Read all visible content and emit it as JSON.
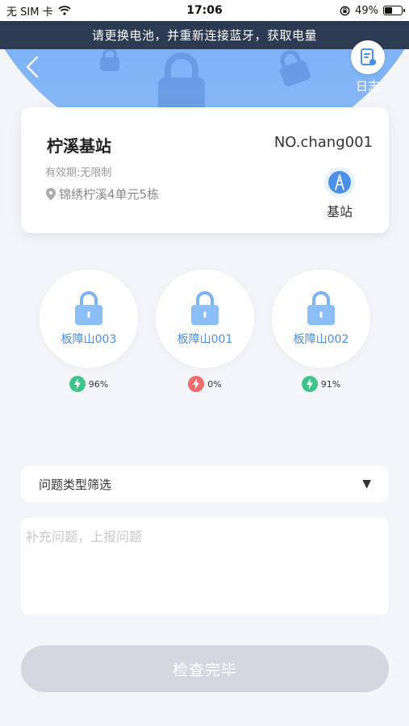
{
  "status_bar": {
    "carrier": "无 SIM 卡",
    "time": "17:06",
    "battery_percent": "49%",
    "battery_level": 0.49
  },
  "banner": {
    "text": "请更换电池，并重新连接蓝牙，获取电量"
  },
  "header": {
    "log_label": "日志"
  },
  "station": {
    "name": "柠溪基站",
    "number": "NO.chang001",
    "validity": "有效期:无限制",
    "address": "锦绣柠溪4单元5栋",
    "type_label": "基站"
  },
  "locks": [
    {
      "name": "板障山003",
      "battery": "96%",
      "status_color": "#3ec48a"
    },
    {
      "name": "板障山001",
      "battery": "0%",
      "status_color": "#f06b6b"
    },
    {
      "name": "板障山002",
      "battery": "91%",
      "status_color": "#3ec48a"
    }
  ],
  "filter": {
    "label": "问题类型筛选"
  },
  "report": {
    "placeholder": "补充问题，上报问题"
  },
  "submit": {
    "label": "检查完毕"
  },
  "colors": {
    "accent": "#4a8fe8",
    "hero": "#6ea6f4",
    "banner": "#2c3a52",
    "button_disabled": "#d3d7e0"
  }
}
